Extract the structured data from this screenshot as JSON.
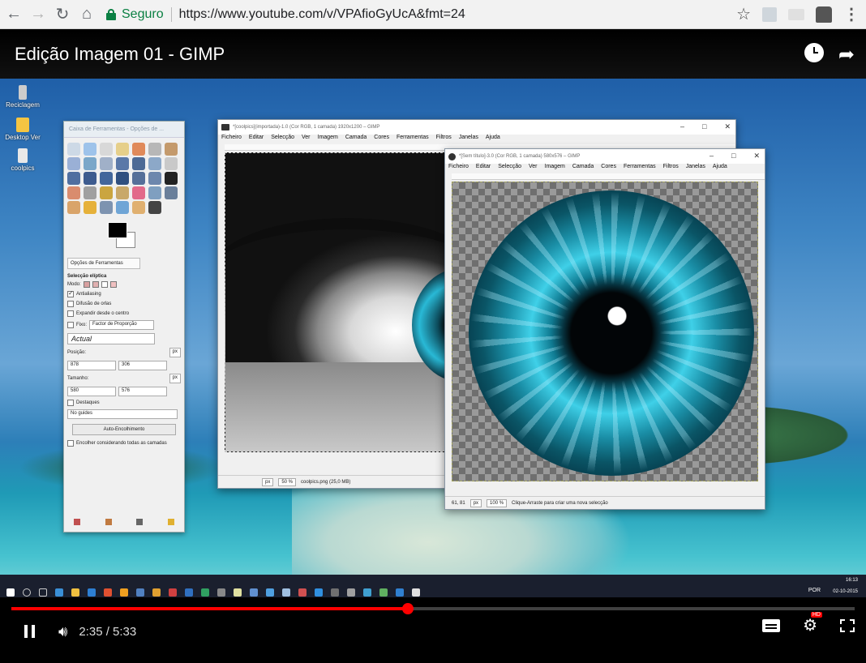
{
  "browser": {
    "secure_label": "Seguro",
    "url": "https://www.youtube.com/v/VPAfioGyUcA&fmt=24"
  },
  "video": {
    "title": "Edição Imagem 01 - GIMP",
    "time": "2:35 / 5:33",
    "progress": 0.47
  },
  "desktop_icons": [
    "Reciclagem",
    "Desktop Ver",
    "coolpics"
  ],
  "toolbox": {
    "title": "Caixa de Ferramentas - Opções de ...",
    "options_tab": "Opções de Ferramentas",
    "heading": "Selecção elíptica",
    "mode_label": "Modo:",
    "antialiasing": "Antialiasing",
    "feather": "Difusão de orlas",
    "expand_center": "Expandir desde o centro",
    "fixed": "Fixo:",
    "fixed_value": "Factor de Proporção",
    "actual": "Actual",
    "position_label": "Posição:",
    "position_unit": "px",
    "pos_x": "878",
    "pos_y": "306",
    "size_label": "Tamanho:",
    "size_unit": "px",
    "size_w": "580",
    "size_h": "576",
    "highlight": "Destaques",
    "guides": "No guides",
    "auto_shrink": "Auto-Encolhimento",
    "shrink_merged": "Encolher considerando todas as camadas"
  },
  "gimp_menu": [
    "Ficheiro",
    "Editar",
    "Selecção",
    "Ver",
    "Imagem",
    "Camada",
    "Cores",
    "Ferramentas",
    "Filtros",
    "Janelas",
    "Ajuda"
  ],
  "window1": {
    "title": "*[coolpics](importada)-1.0 (Cor RGB, 1 camada) 1920x1200 – GIMP",
    "unit": "px",
    "zoom": "50 %",
    "status": "coolpics.png (25,0 MB)"
  },
  "window2": {
    "title": "*[Sem título]-3.0 (Cor RGB, 1 camada) 580x576 – GIMP",
    "coords": "61, 81",
    "unit": "px",
    "zoom": "100 %",
    "status": "Clique-Arraste para criar uma nova selecção"
  },
  "taskbar": {
    "lang": "POR",
    "time": "16:13",
    "date": "02-10-2015"
  },
  "colors": {
    "progress": "#ff0000",
    "secure": "#0b8043"
  }
}
